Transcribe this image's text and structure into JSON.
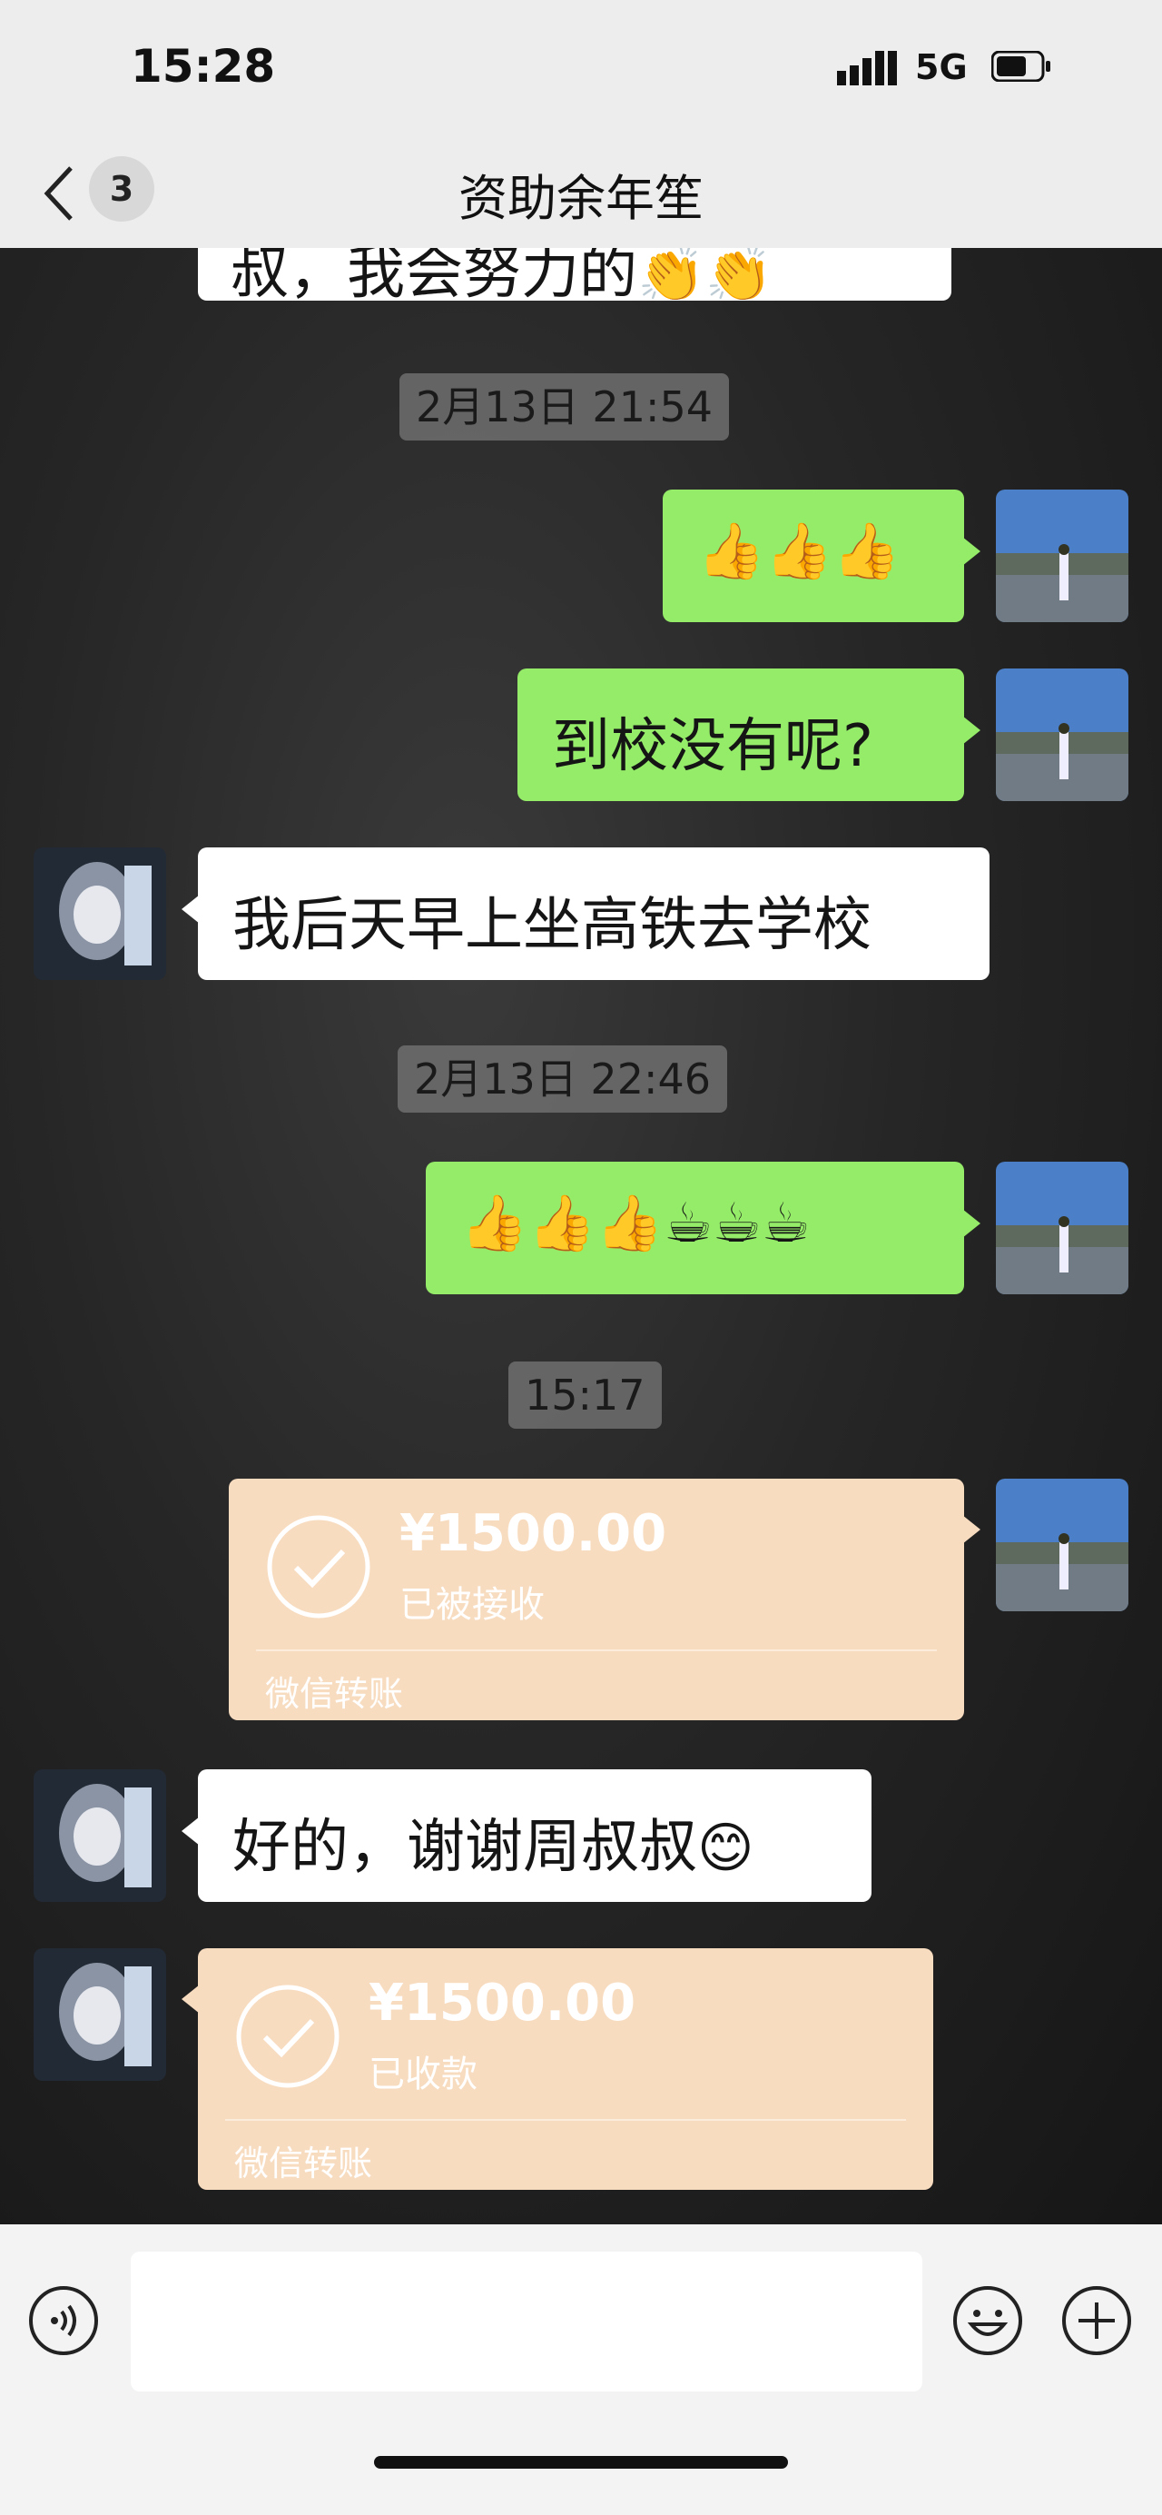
{
  "status_bar": {
    "time": "15:28",
    "network": "5G"
  },
  "nav": {
    "unread_count": "3",
    "title": "资助余年笙"
  },
  "messages": {
    "partial_text": "叔，我会努力的",
    "partial_emoji": "👏👏",
    "stamp1": "2月13日 21:54",
    "thumbs1": "👍👍👍",
    "question": "到校没有呢?",
    "reply1": "我后天早上坐高铁去学校",
    "stamp2": "2月13日 22:46",
    "thumbs_coffee": "👍👍👍☕☕☕",
    "stamp3": "15:17",
    "reply2": "好的，谢谢周叔叔",
    "reply2_emoji": "😊"
  },
  "transfer_sent": {
    "amount": "¥1500.00",
    "status": "已被接收",
    "label": "微信转账"
  },
  "transfer_received": {
    "amount": "¥1500.00",
    "status": "已收款",
    "label": "微信转账"
  },
  "colors": {
    "my_bubble": "#95ec69",
    "their_bubble": "#ffffff",
    "transfer": "#f8dcc0",
    "chrome": "#ededed"
  },
  "icons": [
    "back-chevron-icon",
    "more-dots-icon",
    "voice-icon",
    "emoji-icon",
    "plus-icon",
    "check-circle-icon"
  ]
}
